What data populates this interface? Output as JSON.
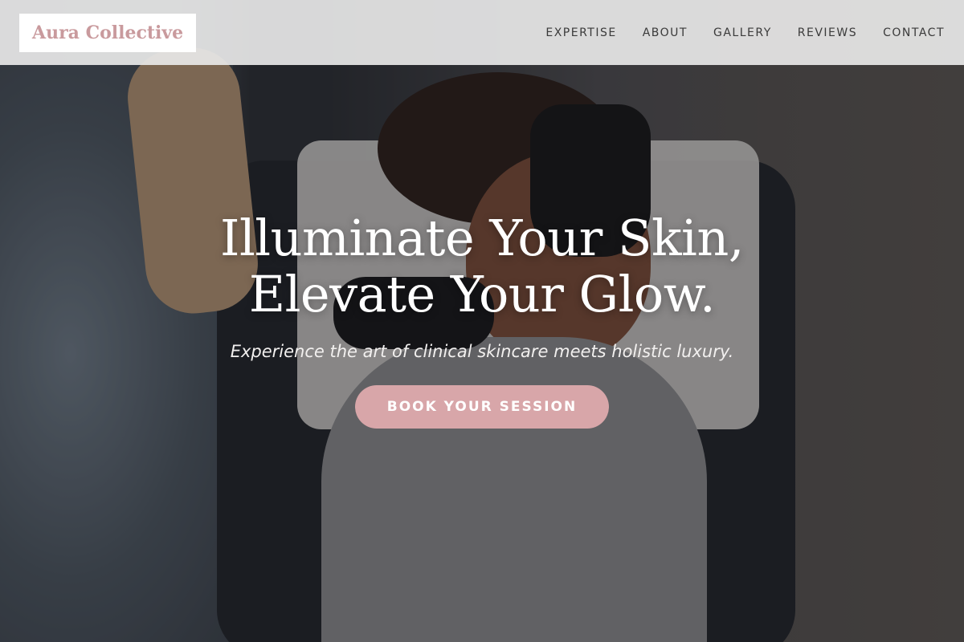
{
  "brand": {
    "name": "Aura Collective",
    "accent_color": "#d8a6a9",
    "logo_text_color": "#c99a9d"
  },
  "nav": {
    "items": [
      {
        "label": "EXPERTISE"
      },
      {
        "label": "ABOUT"
      },
      {
        "label": "GALLERY"
      },
      {
        "label": "REVIEWS"
      },
      {
        "label": "CONTACT"
      }
    ]
  },
  "hero": {
    "headline_line1": "Illuminate Your Skin,",
    "headline_line2": "Elevate Your Glow.",
    "subheadline": "Experience the art of clinical skincare meets holistic luxury.",
    "cta_label": "BOOK YOUR SESSION",
    "background": "photo-facial-treatment"
  }
}
